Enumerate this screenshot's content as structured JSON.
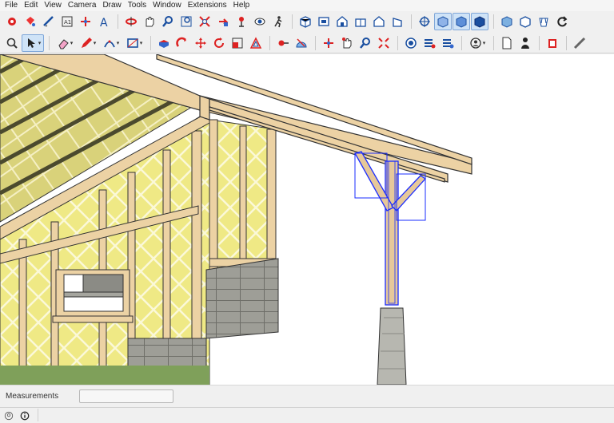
{
  "menubar": {
    "items": [
      "File",
      "Edit",
      "View",
      "Camera",
      "Draw",
      "Tools",
      "Window",
      "Extensions",
      "Help"
    ]
  },
  "measurements": {
    "label": "Measurements",
    "value": ""
  },
  "colors": {
    "toolbar_bg": "#f0f0f0",
    "selection_blue": "#1a2cff",
    "insulation_yellow": "#efe985",
    "timber": "#ecd2a4",
    "concrete": "#b7b7b0"
  },
  "toolbar1_icons": [
    "make-component-icon",
    "paint-bucket-icon",
    "tape-measure-icon",
    "3d-text-icon",
    "section-plane-icon",
    "text-label-icon",
    "orbit-icon",
    "pan-icon",
    "zoom-icon",
    "zoom-window-icon",
    "zoom-extents-icon",
    "previous-view-icon",
    "position-camera-icon",
    "look-around-icon",
    "walk-icon",
    "iso-view-icon",
    "top-view-icon",
    "front-view-icon",
    "right-view-icon",
    "back-view-icon",
    "left-view-icon",
    "perspective-icon",
    "xray-icon",
    "back-edges-icon",
    "wireframe-icon",
    "hidden-line-icon",
    "shaded-icon",
    "shaded-textures-icon",
    "monochrome-icon",
    "refresh-icon"
  ],
  "toolbar2_icons": [
    "search-icon",
    "select-icon",
    "eraser-icon",
    "pencil-icon",
    "arc-icon",
    "rectangle-icon",
    "push-pull-icon",
    "follow-me-icon",
    "move-icon",
    "rotate-icon",
    "scale-icon",
    "offset-icon",
    "tape-icon",
    "protractor-icon",
    "axes-icon",
    "orbit-icon",
    "pan-icon",
    "zoom-icon",
    "zoom-extents-icon",
    "outer-shell-icon",
    "solid-union-icon",
    "solid-subtract-icon",
    "user-account-icon",
    "new-file-icon",
    "person-icon",
    "warehouse-icon",
    "extension-icon"
  ]
}
